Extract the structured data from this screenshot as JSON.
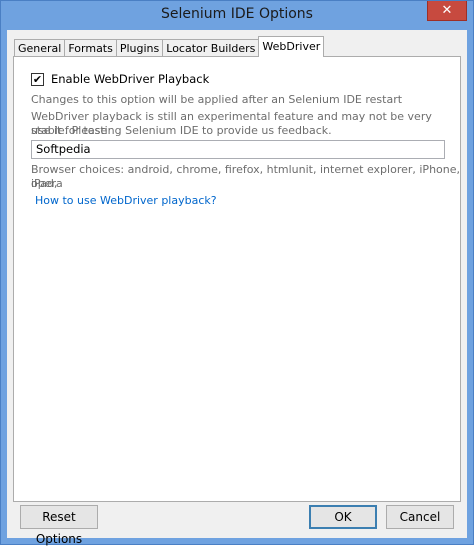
{
  "window": {
    "title": "Selenium IDE Options",
    "close_glyph": "✕"
  },
  "tabs": [
    {
      "label": "General"
    },
    {
      "label": "Formats"
    },
    {
      "label": "Plugins"
    },
    {
      "label": "Locator Builders"
    },
    {
      "label": "WebDriver",
      "active": true
    }
  ],
  "webdriver": {
    "enable_checked": true,
    "check_glyph": "✔",
    "enable_label": "Enable WebDriver Playback",
    "restart_note": "Changes to this option will be applied after an Selenium IDE restart",
    "experimental_note_1": "WebDriver playback is still an experimental feature and may not be very stable. Please",
    "experimental_note_2": "use it for testing Selenium IDE to provide us feedback.",
    "browser_value": "Softpedia",
    "browser_choices_1": "Browser choices: android, chrome, firefox, htmlunit, internet explorer, iPhone, iPad,",
    "browser_choices_2": "opera",
    "help_link": "How to use WebDriver playback?"
  },
  "buttons": {
    "reset": "Reset Options",
    "ok": "OK",
    "cancel": "Cancel"
  },
  "colors": {
    "titlebar": "#6fa2e0",
    "close_button": "#c74a3f",
    "link": "#0066cc"
  }
}
